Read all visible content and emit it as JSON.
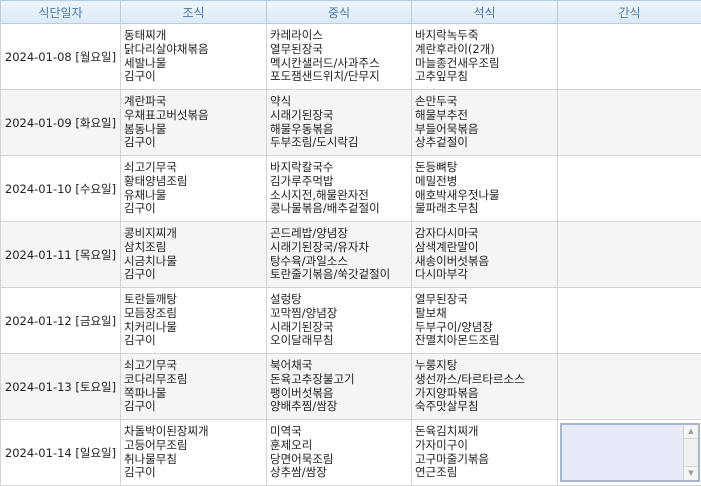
{
  "headers": [
    "식단일자",
    "조식",
    "중식",
    "석식",
    "간식"
  ],
  "rows": [
    {
      "date": "2024-01-08 [월요일]",
      "breakfast": [
        "동태찌개",
        "닭다리살야채볶음",
        "세발나물",
        "김구이"
      ],
      "lunch": [
        "카레라이스",
        "열무된장국",
        "멕시칸샐러드/사과주스",
        "포도잼샌드위치/단무지"
      ],
      "dinner": [
        "바지락녹두죽",
        "계란후라이(2개)",
        "마늘종건새우조림",
        "고추잎무침"
      ]
    },
    {
      "date": "2024-01-09 [화요일]",
      "breakfast": [
        "계란파국",
        "우채표고버섯볶음",
        "봄동나물",
        "김구이"
      ],
      "lunch": [
        "약식",
        "시래기된장국",
        "해물우동볶음",
        "두부조림/도시락김"
      ],
      "dinner": [
        "손만두국",
        "해물부추전",
        "부들어묵볶음",
        "상추겉절이"
      ]
    },
    {
      "date": "2024-01-10 [수요일]",
      "breakfast": [
        "쇠고기무국",
        "황태양념조림",
        "유채나물",
        "김구이"
      ],
      "lunch": [
        "바지락칼국수",
        "김가루주먹밥",
        "소시지전,해물완자전",
        "콩나물볶음/배추겉절이"
      ],
      "dinner": [
        "돈등뼈탕",
        "메밀전병",
        "애호박새우젓나물",
        "물파래초무침"
      ]
    },
    {
      "date": "2024-01-11 [목요일]",
      "breakfast": [
        "콩비지찌개",
        "삼치조림",
        "시금치나물",
        "김구이"
      ],
      "lunch": [
        "곤드레밥/양념장",
        "시래기된장국/유자차",
        "탕수육/과일소스",
        "토란줄기볶음/쑥갓겉절이"
      ],
      "dinner": [
        "감자다시마국",
        "삼색계란말이",
        "새송이버섯볶음",
        "다시마부각"
      ]
    },
    {
      "date": "2024-01-12 [금요일]",
      "breakfast": [
        "토란들깨탕",
        "모듬장조림",
        "치커리나물",
        "김구이"
      ],
      "lunch": [
        "설렁탕",
        "꼬막찜/양념장",
        "시래기된장국",
        "오이달래무침"
      ],
      "dinner": [
        "열무된장국",
        "팔보채",
        "두부구이/양념장",
        "잔멸치아몬드조림"
      ]
    },
    {
      "date": "2024-01-13 [토요일]",
      "breakfast": [
        "쇠고기무국",
        "코다리무조림",
        "쪽파나물",
        "김구이"
      ],
      "lunch": [
        "북어채국",
        "돈육고추장불고기",
        "팽이버섯볶음",
        "양배추찜/쌈장"
      ],
      "dinner": [
        "누룽지탕",
        "생선까스/타르타르소스",
        "가지양파볶음",
        "숙주맛살무침"
      ]
    },
    {
      "date": "2024-01-14 [일요일]",
      "breakfast": [
        "차돌박이된장찌개",
        "고등어무조림",
        "취나물무침",
        "김구이"
      ],
      "lunch": [
        "미역국",
        "훈제오리",
        "당면어묵조림",
        "상추쌈/쌈장"
      ],
      "dinner": [
        "돈육김치찌개",
        "가자미구이",
        "고구마줄기볶음",
        "연근조림"
      ]
    }
  ]
}
